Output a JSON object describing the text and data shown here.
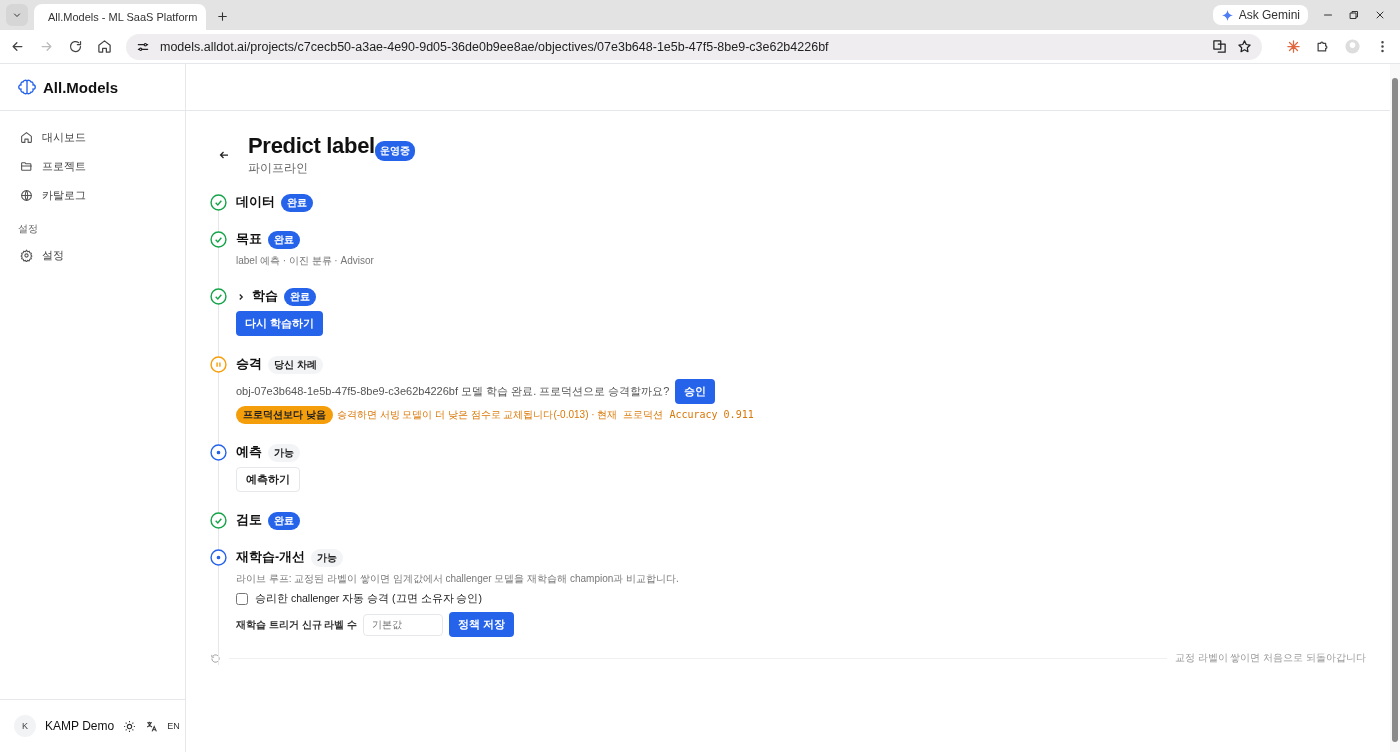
{
  "browser": {
    "tab_title": "All.Models - ML SaaS Platform",
    "gemini": "Ask Gemini",
    "url": "models.alldot.ai/projects/c7cecb50-a3ae-4e90-9d05-36de0b9ee8ae/objectives/07e3b648-1e5b-47f5-8be9-c3e62b4226bf"
  },
  "sidebar": {
    "brand": "All.Models",
    "items": [
      {
        "label": "대시보드"
      },
      {
        "label": "프로젝트"
      },
      {
        "label": "카탈로그"
      }
    ],
    "section": "설정",
    "section_items": [
      {
        "label": "설정"
      }
    ],
    "user": {
      "avatar": "K",
      "name": "KAMP Demo",
      "language": "EN"
    }
  },
  "page": {
    "title": "Predict label",
    "status": "운영중",
    "subtitle": "파이프라인"
  },
  "steps": [
    {
      "kind": "done",
      "label": "데이터",
      "badge": "완료"
    },
    {
      "kind": "done",
      "label": "목표",
      "badge": "완료",
      "note": "label 예측 · 이진 분류 · Advisor"
    },
    {
      "kind": "done",
      "label": "학습",
      "badge": "완료",
      "expandable": true,
      "action": "다시 학습하기"
    },
    {
      "kind": "waiting",
      "label": "승격",
      "badge": "당신 차례",
      "message": "obj-07e3b648-1e5b-47f5-8be9-c3e62b4226bf 모델 학습 완료. 프로덕션으로 승격할까요?",
      "approve": "승인",
      "warning_tag": "프로덕션보다 낮음",
      "warning_text": "승격하면 서빙 모델이 더 낮은 점수로 교체됩니다(-0.013) · ",
      "warning_metric": "현재 프로덕션 Accuracy 0.911"
    },
    {
      "kind": "available",
      "label": "예측",
      "badge": "가능",
      "action": "예측하기"
    },
    {
      "kind": "done",
      "label": "검토",
      "badge": "완료"
    },
    {
      "kind": "available",
      "label": "재학습-개선",
      "badge": "가능",
      "note": "라이브 루프: 교정된 라벨이 쌓이면 임계값에서 challenger 모델을 재학습해 champion과 비교합니다.",
      "checkbox": {
        "label": "승리한 challenger 자동 승격 (끄면 소유자 승인)",
        "checked": false
      },
      "field": {
        "label": "재학습 트리거 신규 라벨 수",
        "placeholder": "기본값"
      },
      "save": "정책 저장"
    }
  ],
  "loop_note": "교정 라벨이 쌓이면 처음으로 되돌아갑니다"
}
